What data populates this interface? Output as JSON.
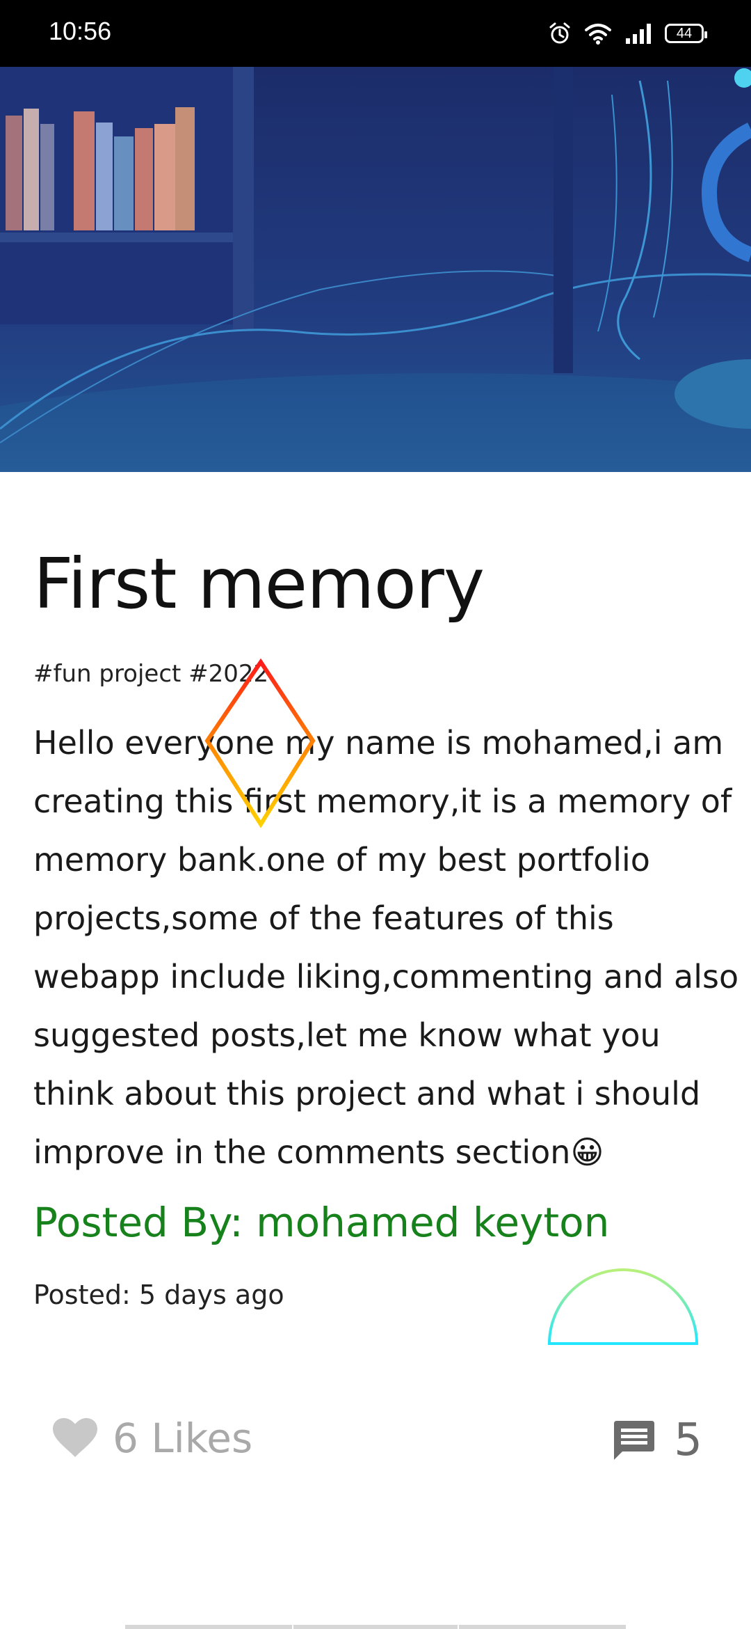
{
  "status_bar": {
    "time": "10:56",
    "battery": "44",
    "icons": [
      "alarm-icon",
      "wifi-icon",
      "signal-icon",
      "battery-icon"
    ]
  },
  "post": {
    "title": "First memory",
    "tags": "#fun project #2022",
    "body_lines": [
      "Hello everyone my name is mohamed,i am",
      "creating this first memory,it is a memory of",
      "memory bank.one of my best portfolio",
      "projects,some of the features of this",
      "webapp include liking,commenting and also",
      "suggested posts,let me know what you",
      "think about this project and what i should",
      "improve in the comments section😀"
    ],
    "posted_by": "Posted By: mohamed keyton",
    "posted_time": "Posted: 5 days ago",
    "likes_label": "6 Likes",
    "comments_count": "5"
  },
  "colors": {
    "author": "#17821c",
    "likes_gray": "#a9a9a9",
    "comment_icon": "#6b6b6b",
    "hero_dark": "#1b2f6e",
    "hero_light": "#2b6aa0"
  }
}
